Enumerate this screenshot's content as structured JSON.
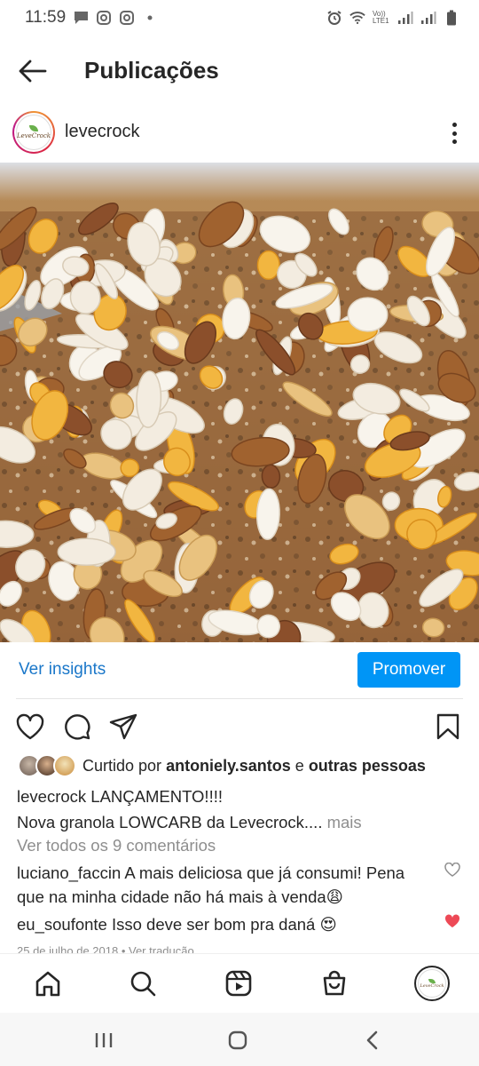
{
  "status": {
    "time": "11:59",
    "icons": [
      "message-icon",
      "instagram-icon",
      "instagram-icon",
      "dot-icon",
      "alarm-icon",
      "wifi-icon",
      "volte-icon",
      "signal-icon",
      "signal-icon",
      "battery-icon"
    ],
    "volte_label": "Vo)) LTE1"
  },
  "header": {
    "title": "Publicações"
  },
  "post": {
    "username": "levecrock",
    "avatar_text": "LeveCrock",
    "insights_label": "Ver insights",
    "promote_label": "Promover",
    "likes_prefix": "Curtido por",
    "likes_user": "antoniely.santos",
    "likes_and": "e",
    "likes_others": "outras pessoas",
    "caption_user": "levecrock",
    "caption_line1": "LANÇAMENTO!!!!",
    "caption_line2": "Nova granola LOWCARB da Levecrock....",
    "caption_more": "mais",
    "view_comments": "Ver todos os 9 comentários",
    "comments": [
      {
        "user": "luciano_faccin",
        "text": "A mais deliciosa que já consumi! Pena que na minha cidade não há mais à venda😩",
        "liked": false
      },
      {
        "user": "eu_soufonte",
        "text": "Isso deve ser bom pra daná 😍",
        "liked": true
      }
    ],
    "timestamp": "25 de julho de 2018",
    "translate": "Ver tradução"
  },
  "colors": {
    "accent": "#0095f6",
    "link": "#1a77c9",
    "like_red": "#ed4956"
  }
}
